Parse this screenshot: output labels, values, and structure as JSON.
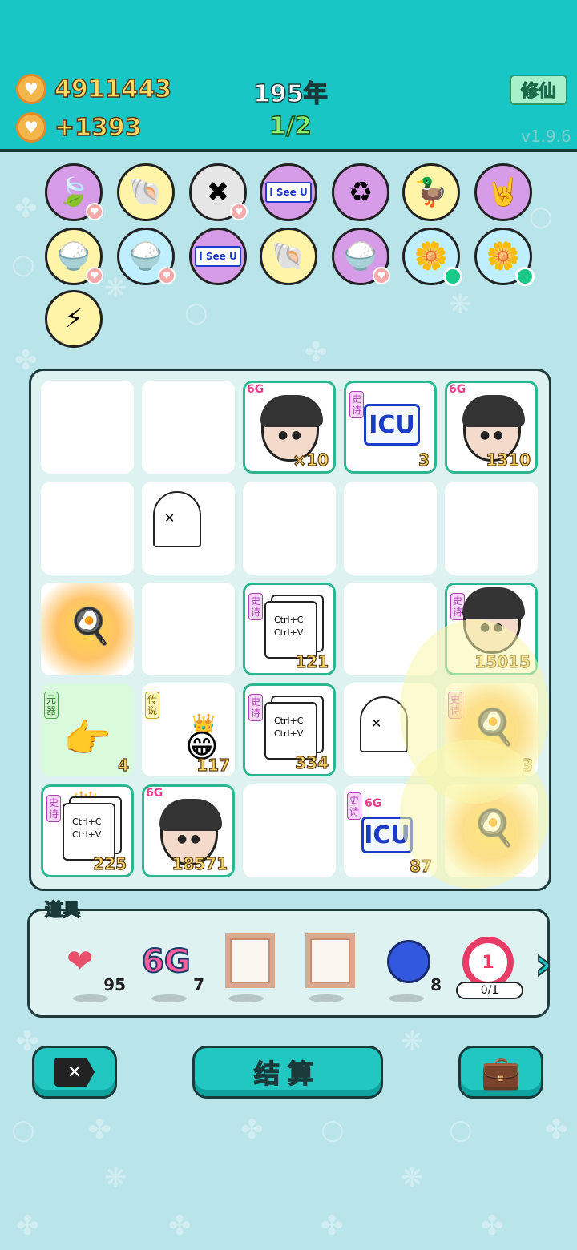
{
  "header": {
    "coins": "4911443",
    "coin_gain": "+1393",
    "year": "195年",
    "round": "1/2",
    "mode_button": "修仙",
    "version": "v1.9.6"
  },
  "relics": [
    {
      "name": "leaf",
      "glyph": "🍃",
      "bg": "#d69ce8"
    },
    {
      "name": "shell",
      "glyph": "🐚",
      "bg": "#fff4a8"
    },
    {
      "name": "skip-tag",
      "glyph": "✖",
      "bg": "#e6e6e6"
    },
    {
      "name": "i-see-u",
      "glyph": "I See U",
      "bg": "#d69ce8"
    },
    {
      "name": "recycle",
      "glyph": "♻",
      "bg": "#d69ce8"
    },
    {
      "name": "duck-pot",
      "glyph": "🦆",
      "bg": "#fff4a8"
    },
    {
      "name": "rock-hand",
      "glyph": "🤘",
      "bg": "#d69ce8"
    },
    {
      "name": "rice-bowl",
      "glyph": "🍚",
      "bg": "#fff4a8"
    },
    {
      "name": "rice-bowl",
      "glyph": "🍚",
      "bg": "#bfefff"
    },
    {
      "name": "i-see-u",
      "glyph": "I See U",
      "bg": "#d69ce8"
    },
    {
      "name": "shell",
      "glyph": "🐚",
      "bg": "#fff4a8"
    },
    {
      "name": "rice-bowl",
      "glyph": "🍚",
      "bg": "#d69ce8"
    },
    {
      "name": "flower-pot",
      "glyph": "🌼",
      "bg": "#bfefff"
    },
    {
      "name": "flower-pot",
      "glyph": "🌼",
      "bg": "#bfefff"
    },
    {
      "name": "lightning",
      "glyph": "⚡",
      "bg": "#fff4a8"
    }
  ],
  "board": {
    "r0c2": {
      "count": "×10",
      "tag": "6G"
    },
    "r0c3": {
      "count": "3",
      "tag": "史诗",
      "label": "ICU"
    },
    "r0c4": {
      "count": "1310",
      "tag": "6G"
    },
    "r2c2": {
      "count": "121",
      "tag": "史诗",
      "line1": "Ctrl+C",
      "line2": "Ctrl+V"
    },
    "r2c4": {
      "count": "15015",
      "tag": "史诗"
    },
    "r3c0": {
      "count": "4",
      "tag": "元器"
    },
    "r3c1": {
      "count": "117",
      "tag": "传说"
    },
    "r3c2": {
      "count": "334",
      "tag": "史诗",
      "line1": "Ctrl+C",
      "line2": "Ctrl+V"
    },
    "r3c4": {
      "count": "3",
      "tag": "史诗"
    },
    "r4c0": {
      "count": "225",
      "tag": "史诗",
      "line1": "Ctrl+C",
      "line2": "Ctrl+V"
    },
    "r4c1": {
      "count": "18571",
      "tag": "6G"
    },
    "r4c3": {
      "count": "87",
      "tag": "史诗",
      "sixg": "6G",
      "label": "ICU"
    }
  },
  "items": {
    "label": "道具",
    "liver_count": "95",
    "sixg_label": "6G",
    "sixg_count": "7",
    "blueberry_count": "8",
    "target_value": "1",
    "target_progress": "0/1"
  },
  "buttons": {
    "settle": "结算"
  },
  "colors": {
    "header_bg": "#19c6c6",
    "page_bg": "#b9e4ea",
    "coin_text": "#ffd966",
    "round_text": "#8cf06c",
    "accent_button": "#23c7c2"
  }
}
